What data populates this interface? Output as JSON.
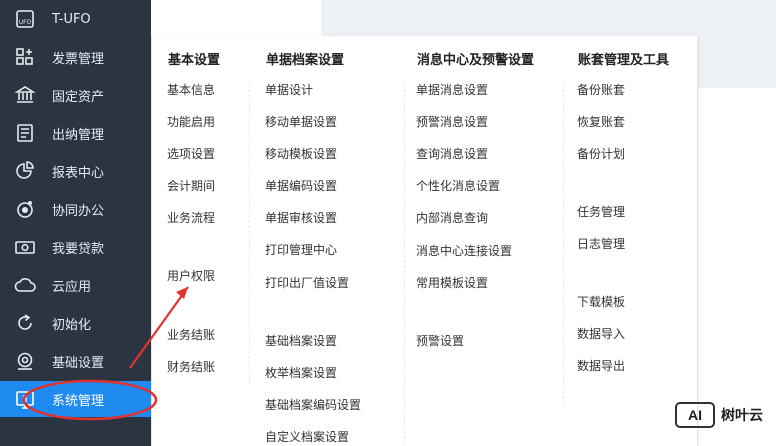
{
  "sidebar": {
    "items": [
      {
        "label": "T-UFO",
        "icon": "tufo-icon"
      },
      {
        "label": "发票管理",
        "icon": "grid-plus-icon"
      },
      {
        "label": "固定资产",
        "icon": "bank-icon"
      },
      {
        "label": "出纳管理",
        "icon": "ledger-icon"
      },
      {
        "label": "报表中心",
        "icon": "pie-chart-icon"
      },
      {
        "label": "协同办公",
        "icon": "collab-icon"
      },
      {
        "label": "我要贷款",
        "icon": "money-icon"
      },
      {
        "label": "云应用",
        "icon": "cloud-icon"
      },
      {
        "label": "初始化",
        "icon": "refresh-icon"
      },
      {
        "label": "基础设置",
        "icon": "settings-icon"
      },
      {
        "label": "系统管理",
        "icon": "system-icon",
        "active": true
      }
    ],
    "active_color": "#1f8af0"
  },
  "menu": {
    "columns": [
      {
        "title": "基本设置",
        "items": [
          "基本信息",
          "功能启用",
          "选项设置",
          "会计期间",
          "业务流程",
          "用户权限",
          "业务结账",
          "财务结账"
        ]
      },
      {
        "title": "单据档案设置",
        "items": [
          "单据设计",
          "移动单据设置",
          "移动模板设置",
          "单据编码设置",
          "单据审核设置",
          "打印管理中心",
          "打印出厂值设置",
          "基础档案设置",
          "枚举档案设置",
          "基础档案编码设置",
          "自定义档案设置"
        ]
      },
      {
        "title": "消息中心及预警设置",
        "items": [
          "单据消息设置",
          "预警消息设置",
          "查询消息设置",
          "个性化消息设置",
          "内部消息查询",
          "消息中心连接设置",
          "常用模板设置",
          "预警设置"
        ]
      },
      {
        "title": "账套管理及工具",
        "items": [
          "备份账套",
          "恢复账套",
          "备份计划",
          "任务管理",
          "日志管理",
          "下载模板",
          "数据导入",
          "数据导出"
        ]
      }
    ]
  },
  "annotation": {
    "color": "#e0332f"
  },
  "watermark": {
    "logo": "AI",
    "text": "树叶云"
  }
}
